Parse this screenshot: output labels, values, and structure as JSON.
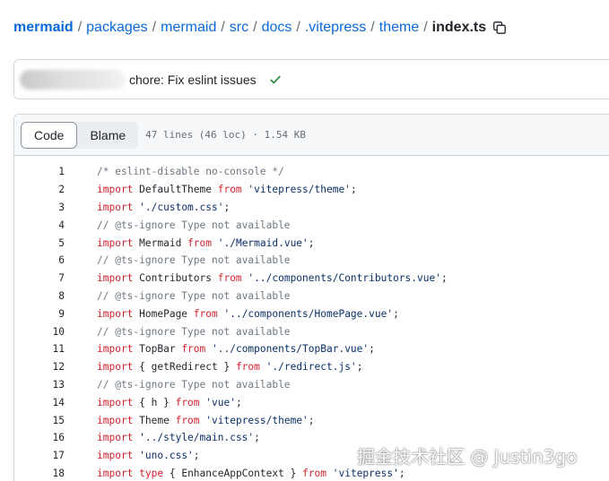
{
  "breadcrumb": {
    "parts": [
      "mermaid",
      "packages",
      "mermaid",
      "src",
      "docs",
      ".vitepress",
      "theme"
    ],
    "separator": "/",
    "current": "index.ts"
  },
  "commit": {
    "message": "chore: Fix eslint issues",
    "status": "success",
    "status_color": "#1a7f37"
  },
  "file": {
    "tabs": [
      "Code",
      "Blame"
    ],
    "active_tab": "Code",
    "info": "47 lines (46 loc) · 1.54 KB"
  },
  "code_lines": [
    {
      "n": "1",
      "tokens": [
        {
          "t": "/* eslint-disable no-console */",
          "c": "cm"
        }
      ]
    },
    {
      "n": "2",
      "tokens": [
        {
          "t": "import",
          "c": "kw"
        },
        {
          "t": " DefaultTheme "
        },
        {
          "t": "from",
          "c": "kw"
        },
        {
          "t": " "
        },
        {
          "t": "'vitepress/theme'",
          "c": "str"
        },
        {
          "t": ";"
        }
      ]
    },
    {
      "n": "3",
      "tokens": [
        {
          "t": "import",
          "c": "kw"
        },
        {
          "t": " "
        },
        {
          "t": "'./custom.css'",
          "c": "str"
        },
        {
          "t": ";"
        }
      ]
    },
    {
      "n": "4",
      "tokens": [
        {
          "t": "// @ts-ignore Type not available",
          "c": "cm"
        }
      ]
    },
    {
      "n": "5",
      "tokens": [
        {
          "t": "import",
          "c": "kw"
        },
        {
          "t": " Mermaid "
        },
        {
          "t": "from",
          "c": "kw"
        },
        {
          "t": " "
        },
        {
          "t": "'./Mermaid.vue'",
          "c": "str"
        },
        {
          "t": ";"
        }
      ]
    },
    {
      "n": "6",
      "tokens": [
        {
          "t": "// @ts-ignore Type not available",
          "c": "cm"
        }
      ]
    },
    {
      "n": "7",
      "tokens": [
        {
          "t": "import",
          "c": "kw"
        },
        {
          "t": " Contributors "
        },
        {
          "t": "from",
          "c": "kw"
        },
        {
          "t": " "
        },
        {
          "t": "'../components/Contributors.vue'",
          "c": "str"
        },
        {
          "t": ";"
        }
      ]
    },
    {
      "n": "8",
      "tokens": [
        {
          "t": "// @ts-ignore Type not available",
          "c": "cm"
        }
      ]
    },
    {
      "n": "9",
      "tokens": [
        {
          "t": "import",
          "c": "kw"
        },
        {
          "t": " HomePage "
        },
        {
          "t": "from",
          "c": "kw"
        },
        {
          "t": " "
        },
        {
          "t": "'../components/HomePage.vue'",
          "c": "str"
        },
        {
          "t": ";"
        }
      ]
    },
    {
      "n": "10",
      "tokens": [
        {
          "t": "// @ts-ignore Type not available",
          "c": "cm"
        }
      ]
    },
    {
      "n": "11",
      "tokens": [
        {
          "t": "import",
          "c": "kw"
        },
        {
          "t": " TopBar "
        },
        {
          "t": "from",
          "c": "kw"
        },
        {
          "t": " "
        },
        {
          "t": "'../components/TopBar.vue'",
          "c": "str"
        },
        {
          "t": ";"
        }
      ]
    },
    {
      "n": "12",
      "tokens": [
        {
          "t": "import",
          "c": "kw"
        },
        {
          "t": " { getRedirect } "
        },
        {
          "t": "from",
          "c": "kw"
        },
        {
          "t": " "
        },
        {
          "t": "'./redirect.js'",
          "c": "str"
        },
        {
          "t": ";"
        }
      ]
    },
    {
      "n": "13",
      "tokens": [
        {
          "t": "// @ts-ignore Type not available",
          "c": "cm"
        }
      ]
    },
    {
      "n": "14",
      "tokens": [
        {
          "t": "import",
          "c": "kw"
        },
        {
          "t": " { h } "
        },
        {
          "t": "from",
          "c": "kw"
        },
        {
          "t": " "
        },
        {
          "t": "'vue'",
          "c": "str"
        },
        {
          "t": ";"
        }
      ]
    },
    {
      "n": "15",
      "tokens": [
        {
          "t": "import",
          "c": "kw"
        },
        {
          "t": " Theme "
        },
        {
          "t": "from",
          "c": "kw"
        },
        {
          "t": " "
        },
        {
          "t": "'vitepress/theme'",
          "c": "str"
        },
        {
          "t": ";"
        }
      ]
    },
    {
      "n": "16",
      "tokens": [
        {
          "t": "import",
          "c": "kw"
        },
        {
          "t": " "
        },
        {
          "t": "'../style/main.css'",
          "c": "str"
        },
        {
          "t": ";"
        }
      ]
    },
    {
      "n": "17",
      "tokens": [
        {
          "t": "import",
          "c": "kw"
        },
        {
          "t": " "
        },
        {
          "t": "'uno.css'",
          "c": "str"
        },
        {
          "t": ";"
        }
      ]
    },
    {
      "n": "18",
      "tokens": [
        {
          "t": "import",
          "c": "kw"
        },
        {
          "t": " "
        },
        {
          "t": "type",
          "c": "kw"
        },
        {
          "t": " { EnhanceAppContext } "
        },
        {
          "t": "from",
          "c": "kw"
        },
        {
          "t": " "
        },
        {
          "t": "'vitepress'",
          "c": "str"
        },
        {
          "t": ";"
        }
      ]
    }
  ],
  "watermark": "掘金技术社区 @ Justin3go",
  "colors": {
    "link": "#0969da",
    "keyword": "#cf222e",
    "string": "#0a3069",
    "comment": "#6e7781"
  }
}
